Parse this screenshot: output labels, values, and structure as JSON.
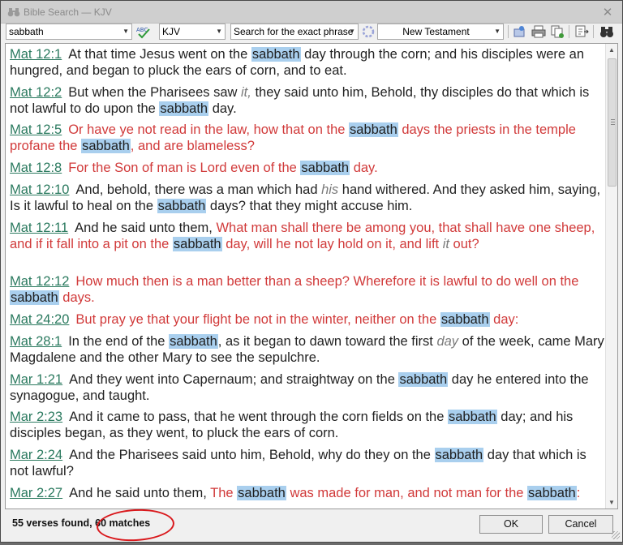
{
  "window": {
    "title": "Bible Search — KJV",
    "close_symbol": "✕"
  },
  "toolbar": {
    "search_value": "sabbath",
    "version_value": "KJV",
    "mode_value": "Search for the exact phrase",
    "scope_value": "New Testament"
  },
  "verses": [
    {
      "ref": "Mat 12:1",
      "parts": [
        {
          "t": "At that time Jesus went on the ",
          "s": "n"
        },
        {
          "t": "sabbath",
          "s": "h"
        },
        {
          "t": " day through the corn; and his disciples were an hungred, and began to pluck the ears of corn, and to eat.",
          "s": "n"
        }
      ]
    },
    {
      "ref": "Mat 12:2",
      "parts": [
        {
          "t": "But when the Pharisees saw ",
          "s": "n"
        },
        {
          "t": "it,",
          "s": "i"
        },
        {
          "t": " they said unto him, Behold, thy disciples do that which is not lawful to do upon the ",
          "s": "n"
        },
        {
          "t": "sabbath",
          "s": "h"
        },
        {
          "t": " day.",
          "s": "n"
        }
      ]
    },
    {
      "ref": "Mat 12:5",
      "parts": [
        {
          "t": "Or have ye not read in the law, how that on the ",
          "s": "r"
        },
        {
          "t": "sabbath",
          "s": "h"
        },
        {
          "t": " days the priests in the temple profane the ",
          "s": "r"
        },
        {
          "t": "sabbath",
          "s": "h"
        },
        {
          "t": ", and are blameless?",
          "s": "r"
        }
      ]
    },
    {
      "ref": "Mat 12:8",
      "parts": [
        {
          "t": "For the Son of man is Lord even of the ",
          "s": "r"
        },
        {
          "t": "sabbath",
          "s": "h"
        },
        {
          "t": " day.",
          "s": "r"
        }
      ]
    },
    {
      "ref": "Mat 12:10",
      "parts": [
        {
          "t": "And, behold, there was a man which had ",
          "s": "n"
        },
        {
          "t": "his",
          "s": "i"
        },
        {
          "t": " hand withered. And they asked him, saying, Is it lawful to heal on the ",
          "s": "n"
        },
        {
          "t": "sabbath",
          "s": "h"
        },
        {
          "t": " days? that they might accuse him.",
          "s": "n"
        }
      ]
    },
    {
      "ref": "Mat 12:11",
      "parts": [
        {
          "t": "And he said unto them, ",
          "s": "n"
        },
        {
          "t": "What man shall there be among you, that shall have one sheep, and if it fall into a pit on the ",
          "s": "r"
        },
        {
          "t": "sabbath",
          "s": "h"
        },
        {
          "t": " day, will he not lay hold on it, and lift ",
          "s": "r"
        },
        {
          "t": "it",
          "s": "i"
        },
        {
          "t": " out?",
          "s": "r"
        }
      ]
    },
    {
      "ref": "Mat 12:12",
      "parts": [
        {
          "t": "How much then is a man better than a sheep? Wherefore it is lawful to do well on the ",
          "s": "r"
        },
        {
          "t": "sabbath",
          "s": "h"
        },
        {
          "t": " days.",
          "s": "r"
        }
      ]
    },
    {
      "ref": "Mat 24:20",
      "parts": [
        {
          "t": "But pray ye that your flight be not in the winter, neither on the ",
          "s": "r"
        },
        {
          "t": "sabbath",
          "s": "h"
        },
        {
          "t": " day:",
          "s": "r"
        }
      ]
    },
    {
      "ref": "Mat 28:1",
      "parts": [
        {
          "t": "In the end of the ",
          "s": "n"
        },
        {
          "t": "sabbath",
          "s": "h"
        },
        {
          "t": ", as it began to dawn toward the first ",
          "s": "n"
        },
        {
          "t": "day",
          "s": "i"
        },
        {
          "t": " of the week, came Mary Magdalene and the other Mary to see the sepulchre.",
          "s": "n"
        }
      ]
    },
    {
      "ref": "Mar 1:21",
      "parts": [
        {
          "t": "And they went into Capernaum; and straightway on the ",
          "s": "n"
        },
        {
          "t": "sabbath",
          "s": "h"
        },
        {
          "t": " day he entered into the synagogue, and taught.",
          "s": "n"
        }
      ]
    },
    {
      "ref": "Mar 2:23",
      "parts": [
        {
          "t": "And it came to pass, that he went through the corn fields on the ",
          "s": "n"
        },
        {
          "t": "sabbath",
          "s": "h"
        },
        {
          "t": " day; and his disciples began, as they went, to pluck the ears of corn.",
          "s": "n"
        }
      ]
    },
    {
      "ref": "Mar 2:24",
      "parts": [
        {
          "t": "And the Pharisees said unto him, Behold, why do they on the ",
          "s": "n"
        },
        {
          "t": "sabbath",
          "s": "h"
        },
        {
          "t": " day that which is not lawful?",
          "s": "n"
        }
      ]
    },
    {
      "ref": "Mar 2:27",
      "parts": [
        {
          "t": "And he said unto them, ",
          "s": "n"
        },
        {
          "t": "The ",
          "s": "r"
        },
        {
          "t": "sabbath",
          "s": "h"
        },
        {
          "t": " was made for man, and not man for the ",
          "s": "r"
        },
        {
          "t": "sabbath",
          "s": "h"
        },
        {
          "t": ":",
          "s": "r"
        }
      ]
    }
  ],
  "status": {
    "verses_found": "55 verses found,",
    "matches": "60 matches"
  },
  "buttons": {
    "ok": "OK",
    "cancel": "Cancel"
  },
  "colors": {
    "highlight": "#a9cfee",
    "red_letter": "#d13a3a",
    "reference": "#2b7a5f",
    "annotation_circle": "#d9181c"
  }
}
